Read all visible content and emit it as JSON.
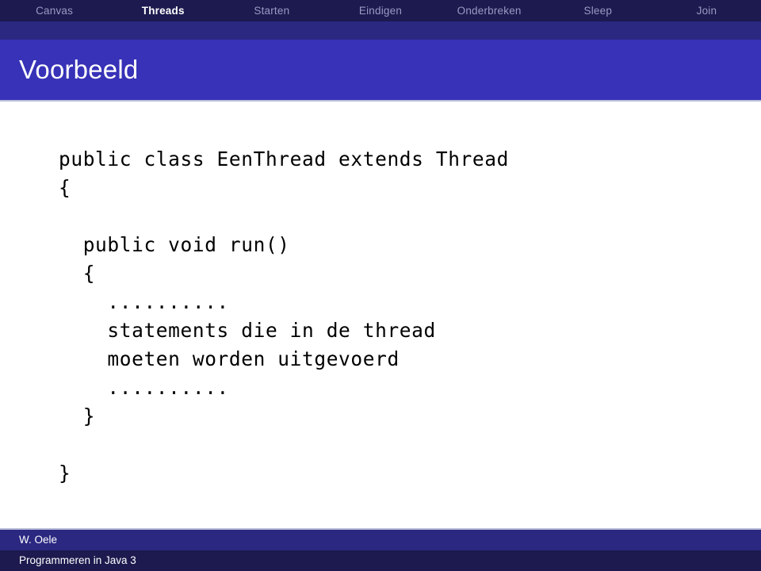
{
  "navbar": {
    "items": [
      {
        "label": "Canvas",
        "active": false
      },
      {
        "label": "Threads",
        "active": true
      },
      {
        "label": "Starten",
        "active": false
      },
      {
        "label": "Eindigen",
        "active": false
      },
      {
        "label": "Onderbreken",
        "active": false
      },
      {
        "label": "Sleep",
        "active": false
      },
      {
        "label": "Join",
        "active": false
      }
    ],
    "active_label": "Threads",
    "background_color": "#1c1a4e",
    "inactive_text_color": "#9a9ac4",
    "active_text_color": "#ffffff"
  },
  "title": {
    "text": "Voorbeeld",
    "background_color": "#3732b7",
    "text_color": "#ffffff"
  },
  "code": {
    "language": "java",
    "lines": [
      "public class EenThread extends Thread",
      "{",
      "",
      "  public void run()",
      "  {",
      "    ..........",
      "    statements die in de thread",
      "    moeten worden uitgevoerd",
      "    ..........",
      "  }",
      "",
      "}"
    ],
    "text_color": "#000000"
  },
  "footer": {
    "author": "W. Oele",
    "course": "Programmeren in Java 3",
    "top_background_color": "#2b2882",
    "bottom_background_color": "#1c1a4e",
    "text_color": "#ffffff"
  }
}
